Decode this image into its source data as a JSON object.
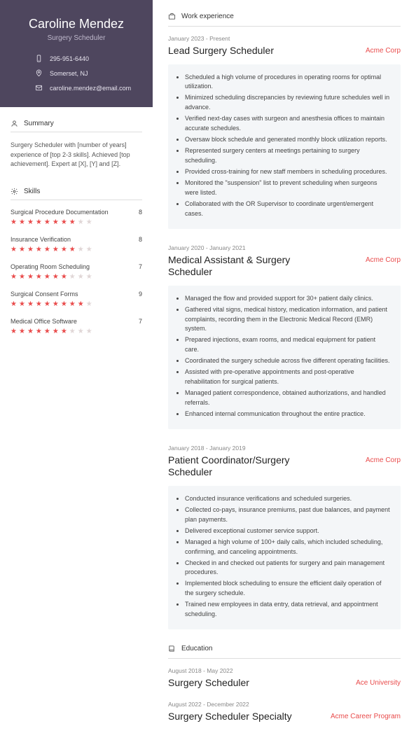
{
  "name": "Caroline Mendez",
  "title": "Surgery Scheduler",
  "contacts": [
    {
      "icon": "phone",
      "value": "295-951-6440"
    },
    {
      "icon": "location",
      "value": "Somerset, NJ"
    },
    {
      "icon": "email",
      "value": "caroline.mendez@email.com"
    }
  ],
  "summary_heading": "Summary",
  "summary": "Surgery Scheduler with [number of years] experience of [top 2-3 skills]. Achieved [top achievement]. Expert at [X], [Y] and [Z].",
  "skills_heading": "Skills",
  "skills": [
    {
      "name": "Surgical Procedure Documentation",
      "score": 8
    },
    {
      "name": "Insurance Verification",
      "score": 8
    },
    {
      "name": "Operating Room Scheduling",
      "score": 7
    },
    {
      "name": "Surgical Consent Forms",
      "score": 9
    },
    {
      "name": "Medical Office Software",
      "score": 7
    }
  ],
  "work_heading": "Work experience",
  "jobs": [
    {
      "dates": "January 2023 - Present",
      "title": "Lead Surgery Scheduler",
      "company": "Acme Corp",
      "bullets": [
        "Scheduled a high volume of procedures in operating rooms for optimal utilization.",
        "Minimized scheduling discrepancies by reviewing future schedules well in advance.",
        "Verified next-day cases with surgeon and anesthesia offices to maintain accurate schedules.",
        "Oversaw block schedule and generated monthly block utilization reports.",
        "Represented surgery centers at meetings pertaining to surgery scheduling.",
        "Provided cross-training for new staff members in scheduling procedures.",
        "Monitored the \"suspension\" list to prevent scheduling when surgeons were listed.",
        "Collaborated with the OR Supervisor to coordinate urgent/emergent cases."
      ]
    },
    {
      "dates": "January 2020 - January 2021",
      "title": "Medical Assistant & Surgery Scheduler",
      "company": "Acme Corp",
      "bullets": [
        "Managed the flow and provided support for 30+ patient daily clinics.",
        "Gathered vital signs, medical history, medication information, and patient complaints, recording them in the Electronic Medical Record (EMR) system.",
        "Prepared injections, exam rooms, and medical equipment for patient care.",
        "Coordinated the surgery schedule across five different operating facilities.",
        "Assisted with pre-operative appointments and post-operative rehabilitation for surgical patients.",
        "Managed patient correspondence, obtained authorizations, and handled referrals.",
        "Enhanced internal communication throughout the entire practice."
      ]
    },
    {
      "dates": "January 2018 - January 2019",
      "title": "Patient Coordinator/Surgery Scheduler",
      "company": "Acme Corp",
      "bullets": [
        "Conducted insurance verifications and scheduled surgeries.",
        "Collected co-pays, insurance premiums, past due balances, and payment plan payments.",
        "Delivered exceptional customer service support.",
        "Managed a high volume of 100+ daily calls, which included scheduling, confirming, and canceling appointments.",
        "Checked in and checked out patients for surgery and pain management procedures.",
        "Implemented block scheduling to ensure the efficient daily operation of the surgery schedule.",
        "Trained new employees in data entry, data retrieval, and appointment scheduling."
      ]
    }
  ],
  "education_heading": "Education",
  "education": [
    {
      "dates": "August 2018 - May 2022",
      "title": "Surgery Scheduler",
      "school": "Ace University"
    },
    {
      "dates": "August 2022 - December 2022",
      "title": "Surgery Scheduler Specialty",
      "school": "Acme Career Program"
    }
  ],
  "chart_data": {
    "type": "bar",
    "title": "Skills",
    "categories": [
      "Surgical Procedure Documentation",
      "Insurance Verification",
      "Operating Room Scheduling",
      "Surgical Consent Forms",
      "Medical Office Software"
    ],
    "values": [
      8,
      8,
      7,
      9,
      7
    ],
    "ylim": [
      0,
      10
    ]
  }
}
